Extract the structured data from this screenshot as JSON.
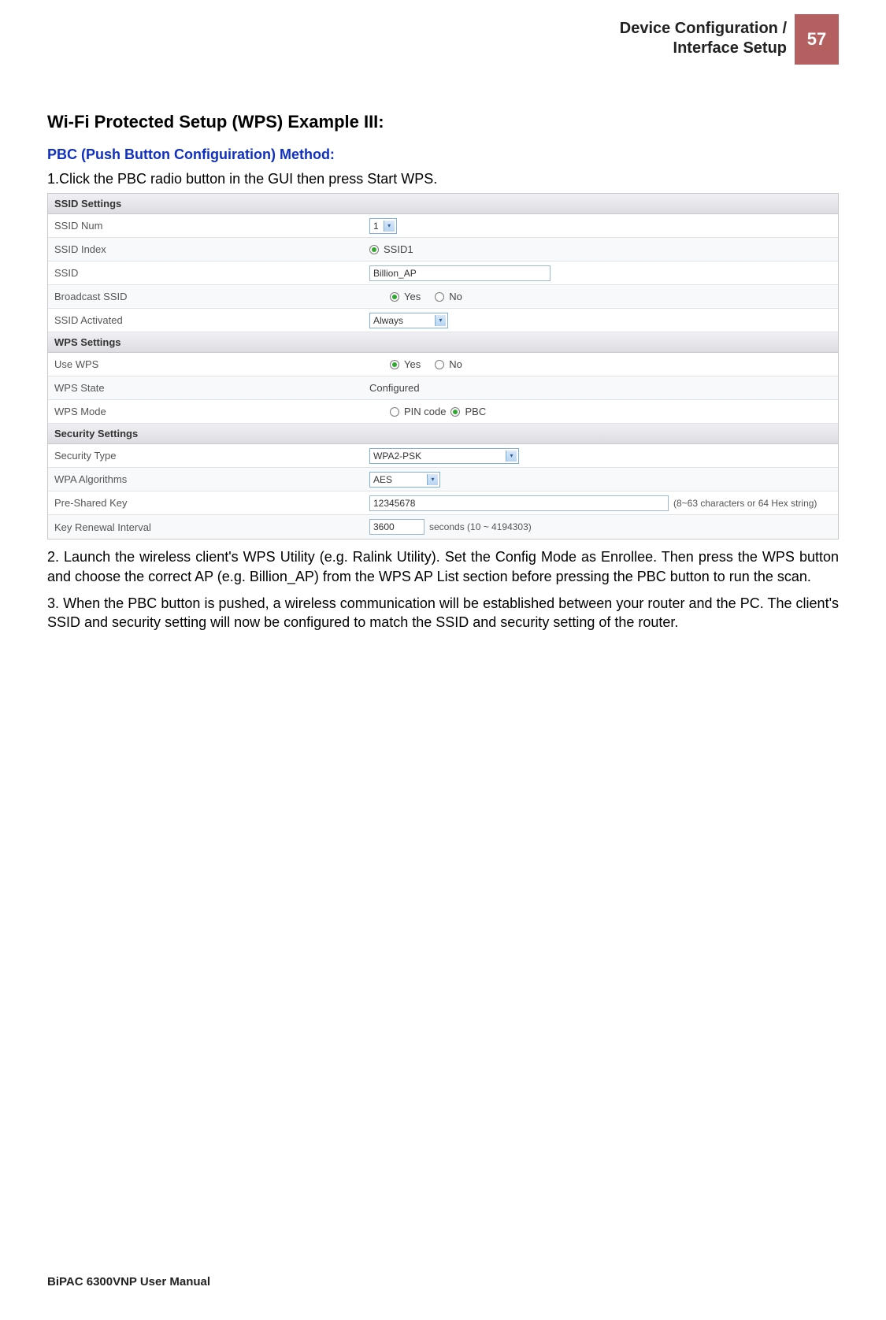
{
  "header": {
    "title_line1": "Device Configuration /",
    "title_line2": "Interface Setup",
    "page_number": "57"
  },
  "content": {
    "h1": "Wi-Fi Protected Setup (WPS) Example III:",
    "h2": "PBC (Push Button Configuiration) Method:",
    "step1": "1.Click the PBC radio button in the GUI then press Start WPS.",
    "step2": "2. Launch the wireless client's WPS Utility (e.g. Ralink Utility). Set the Config Mode as Enrollee. Then press the WPS button and choose the correct AP (e.g. Billion_AP) from the WPS AP List section before pressing the PBC button to run the scan.",
    "step3": "3.  When the PBC button is pushed, a wireless communication will be established between your router and the PC. The client's SSID and security setting will now be configured to match the SSID and security setting of the router."
  },
  "settings": {
    "ssid_section": "SSID Settings",
    "ssid_num_label": "SSID Num",
    "ssid_num_value": "1",
    "ssid_index_label": "SSID Index",
    "ssid_index_value": "SSID1",
    "ssid_label": "SSID",
    "ssid_value": "Billion_AP",
    "broadcast_label": "Broadcast SSID",
    "yes": "Yes",
    "no": "No",
    "activated_label": "SSID Activated",
    "activated_value": "Always",
    "wps_section": "WPS Settings",
    "use_wps_label": "Use WPS",
    "wps_state_label": "WPS State",
    "wps_state_value": "Configured",
    "wps_mode_label": "WPS Mode",
    "pin_code": "PIN code",
    "pbc": "PBC",
    "security_section": "Security Settings",
    "security_type_label": "Security Type",
    "security_type_value": "WPA2-PSK",
    "wpa_alg_label": "WPA Algorithms",
    "wpa_alg_value": "AES",
    "psk_label": "Pre-Shared Key",
    "psk_value": "12345678",
    "psk_note": "(8~63 characters or 64 Hex string)",
    "key_renewal_label": "Key Renewal Interval",
    "key_renewal_value": "3600",
    "key_renewal_note": "seconds   (10 ~ 4194303)"
  },
  "footer": "BiPAC 6300VNP User Manual"
}
